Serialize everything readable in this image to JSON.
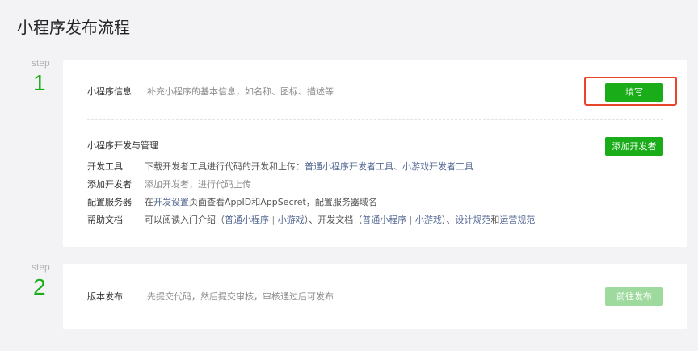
{
  "page": {
    "title": "小程序发布流程"
  },
  "step1": {
    "word": "step",
    "number": "1",
    "info": {
      "label": "小程序信息",
      "description": "补充小程序的基本信息，如名称、图标、描述等",
      "button": "填写"
    },
    "dev": {
      "section_title": "小程序开发与管理",
      "add_dev_button": "添加开发者",
      "rows": {
        "tools": {
          "label": "开发工具",
          "prefix": "下载开发者工具进行代码的开发和上传：",
          "link1": "普通小程序开发者工具",
          "sep": "、",
          "link2": "小游戏开发者工具"
        },
        "add_dev": {
          "label": "添加开发者",
          "text": "添加开发者，进行代码上传"
        },
        "server": {
          "label": "配置服务器",
          "prefix": "在",
          "link": "开发设置",
          "suffix": "页面查看AppID和AppSecret，配置服务器域名"
        },
        "docs": {
          "label": "帮助文档",
          "p1": "可以阅读入门介绍（",
          "l1": "普通小程序",
          "s1": " | ",
          "l2": "小游戏",
          "p2": "）、开发文档（",
          "l3": "普通小程序",
          "s2": " | ",
          "l4": "小游戏",
          "p3": "）、",
          "l5": "设计规范",
          "p4": "和",
          "l6": "运营规范"
        }
      }
    }
  },
  "step2": {
    "word": "step",
    "number": "2",
    "label": "版本发布",
    "description": "先提交代码，然后提交审核，审核通过后可发布",
    "button": "前往发布"
  }
}
